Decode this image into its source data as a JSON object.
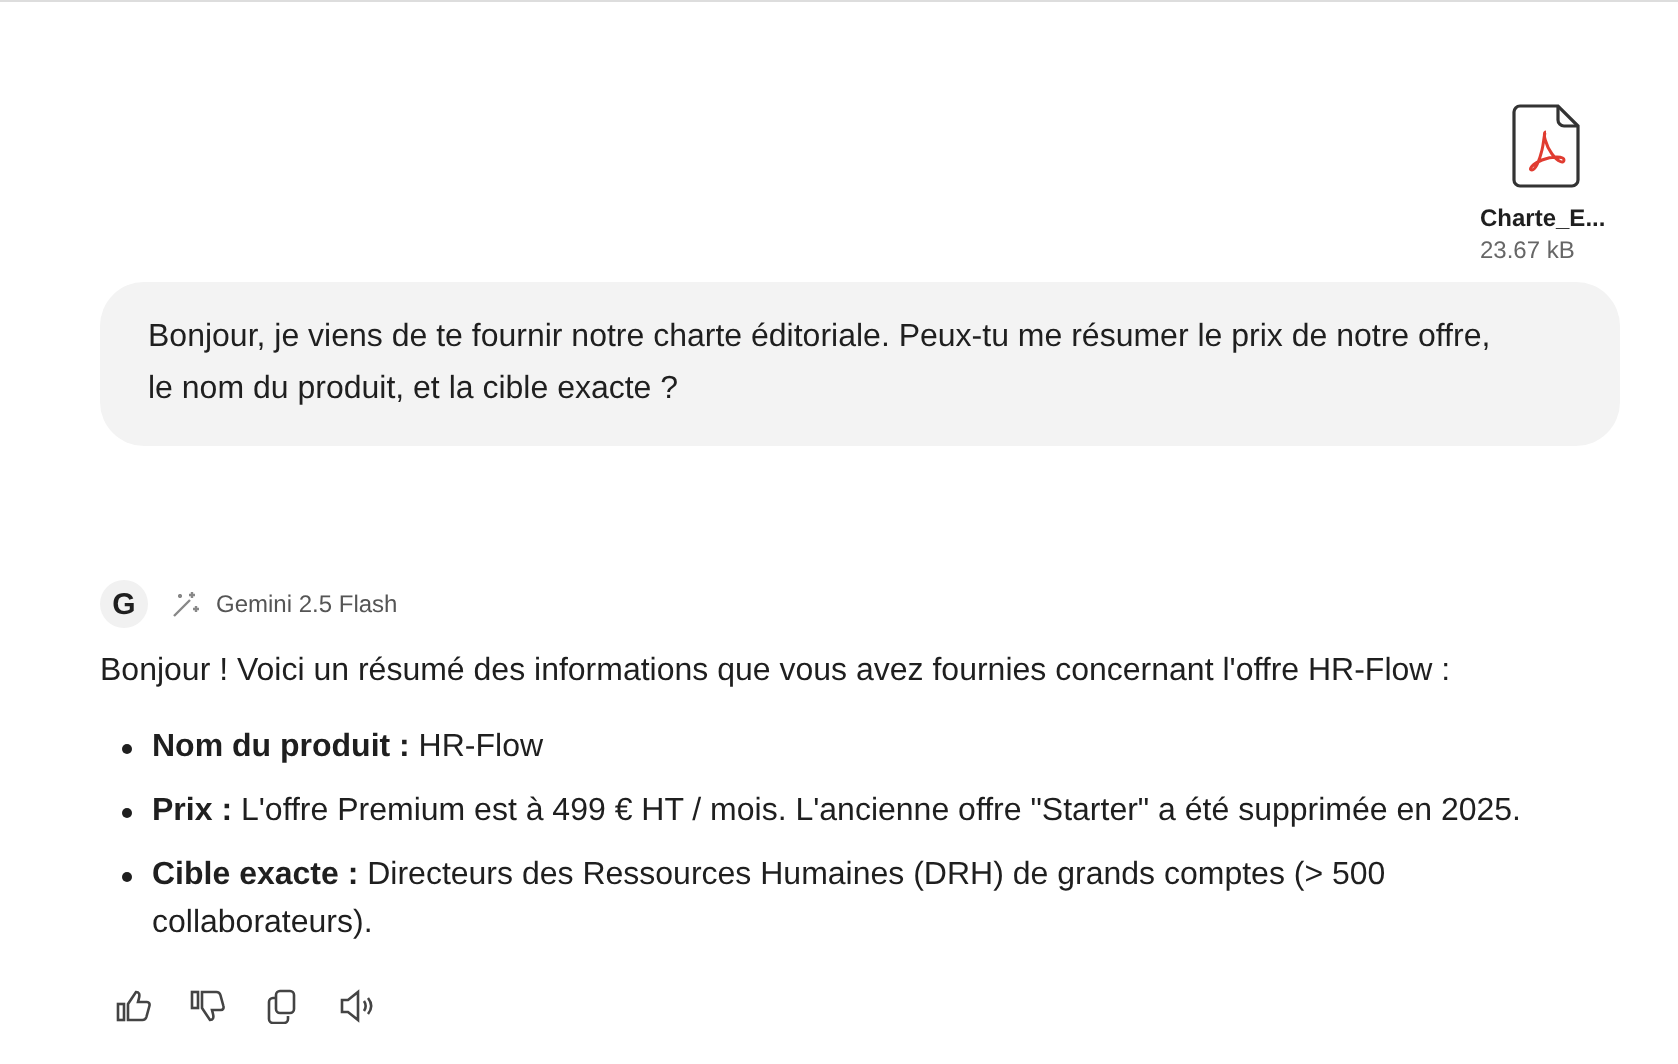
{
  "attachment": {
    "name": "Charte_E...",
    "size": "23.67 kB"
  },
  "user_message": "Bonjour, je viens de te fournir notre charte éditoriale. Peux-tu me résumer le prix de notre offre, le nom du produit, et la cible exacte ?",
  "response": {
    "avatar": "G",
    "model": "Gemini 2.5 Flash",
    "intro": "Bonjour ! Voici un résumé des informations que vous avez fournies concernant l'offre HR-Flow :",
    "bullets": [
      "**Nom du produit :** HR-Flow",
      "**Prix :** L'offre Premium est à 499 € HT / mois. L'ancienne offre \"Starter\" a été supprimée en 2025.",
      "**Cible exacte :** Directeurs des Ressources Humaines (DRH) de grands comptes (> 500 collaborateurs)."
    ]
  }
}
